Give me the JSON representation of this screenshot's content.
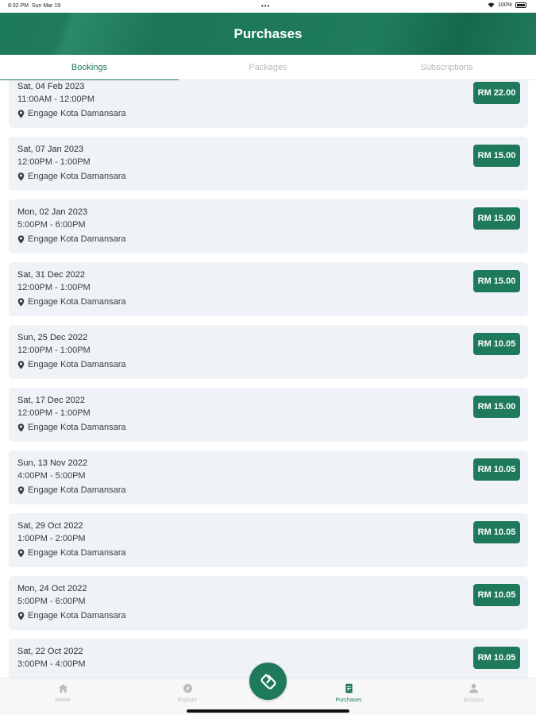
{
  "status_bar": {
    "time": "8:32 PM",
    "date": "Sun Mar 19",
    "dots": "•••",
    "battery": "100%"
  },
  "header": {
    "title": "Purchases"
  },
  "tabs": [
    {
      "label": "Bookings",
      "active": true
    },
    {
      "label": "Packages",
      "active": false
    },
    {
      "label": "Subscriptions",
      "active": false
    }
  ],
  "bookings": [
    {
      "date": "Sat, 04 Feb 2023",
      "time": "11:00AM - 12:00PM",
      "venue": "Engage Kota Damansara",
      "price": "RM 22.00"
    },
    {
      "date": "Sat, 07 Jan 2023",
      "time": "12:00PM - 1:00PM",
      "venue": "Engage Kota Damansara",
      "price": "RM 15.00"
    },
    {
      "date": "Mon, 02 Jan 2023",
      "time": "5:00PM - 6:00PM",
      "venue": "Engage Kota Damansara",
      "price": "RM 15.00"
    },
    {
      "date": "Sat, 31 Dec 2022",
      "time": "12:00PM - 1:00PM",
      "venue": "Engage Kota Damansara",
      "price": "RM 15.00"
    },
    {
      "date": "Sun, 25 Dec 2022",
      "time": "12:00PM - 1:00PM",
      "venue": "Engage Kota Damansara",
      "price": "RM 10.05"
    },
    {
      "date": "Sat, 17 Dec 2022",
      "time": "12:00PM - 1:00PM",
      "venue": "Engage Kota Damansara",
      "price": "RM 15.00"
    },
    {
      "date": "Sun, 13 Nov 2022",
      "time": "4:00PM - 5:00PM",
      "venue": "Engage Kota Damansara",
      "price": "RM 10.05"
    },
    {
      "date": "Sat, 29 Oct 2022",
      "time": "1:00PM - 2:00PM",
      "venue": "Engage Kota Damansara",
      "price": "RM 10.05"
    },
    {
      "date": "Mon, 24 Oct 2022",
      "time": "5:00PM - 6:00PM",
      "venue": "Engage Kota Damansara",
      "price": "RM 10.05"
    },
    {
      "date": "Sat, 22 Oct 2022",
      "time": "3:00PM - 4:00PM",
      "venue": "",
      "price": "RM 10.05"
    }
  ],
  "bottom_nav": [
    {
      "label": "Home",
      "icon": "home-icon",
      "active": false
    },
    {
      "label": "Explore",
      "icon": "compass-icon",
      "active": false
    },
    {
      "label": "Purchases",
      "icon": "receipt-icon",
      "active": true
    },
    {
      "label": "Account",
      "icon": "person-icon",
      "active": false
    }
  ],
  "fab": {
    "icon": "brand-logo-icon"
  },
  "colors": {
    "brand_green": "#1f7a5c",
    "card_bg": "#eff2f7",
    "tab_inactive": "#b5b8bd"
  }
}
